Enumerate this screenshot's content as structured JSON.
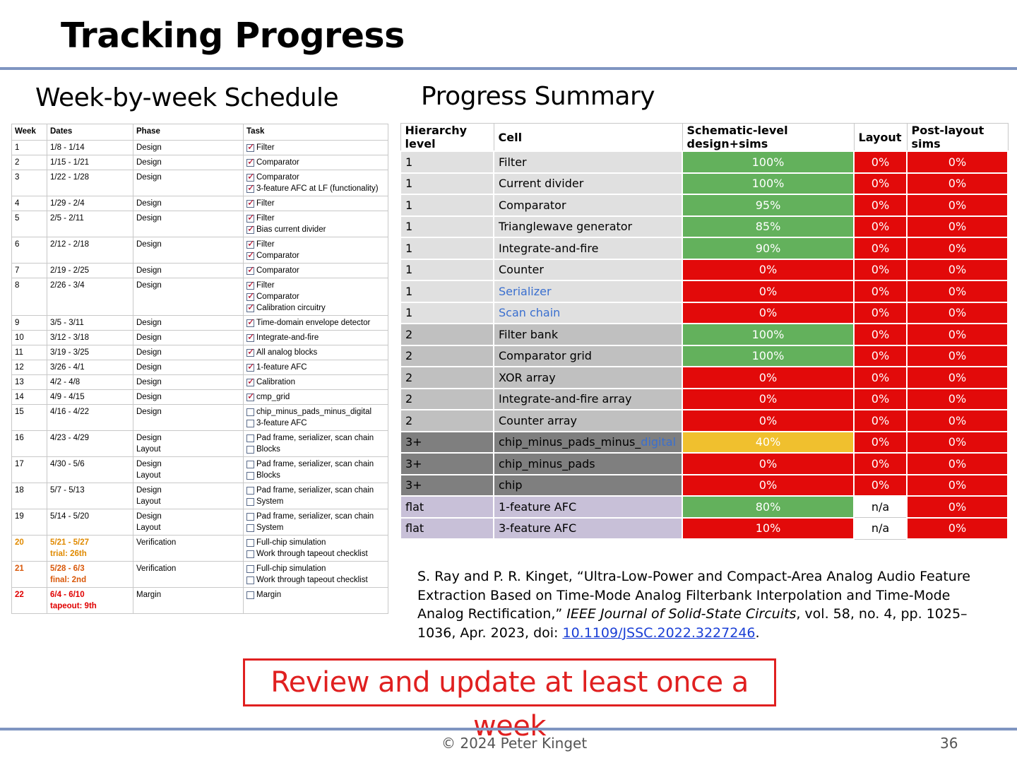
{
  "title": "Tracking Progress",
  "schedule": {
    "heading": "Week-by-week Schedule",
    "columns": [
      "Week",
      "Dates",
      "Phase",
      "Task"
    ],
    "rows": [
      {
        "week": "1",
        "dates": "1/8 - 1/14",
        "phase": [
          "Design"
        ],
        "tasks": [
          {
            "label": "Filter",
            "checked": true
          }
        ]
      },
      {
        "week": "2",
        "dates": "1/15 - 1/21",
        "phase": [
          "Design"
        ],
        "tasks": [
          {
            "label": "Comparator",
            "checked": true
          }
        ]
      },
      {
        "week": "3",
        "dates": "1/22 - 1/28",
        "phase": [
          "Design"
        ],
        "tasks": [
          {
            "label": "Comparator",
            "checked": true
          },
          {
            "label": "3-feature AFC at LF (functionality)",
            "checked": true
          }
        ]
      },
      {
        "week": "4",
        "dates": "1/29 - 2/4",
        "phase": [
          "Design"
        ],
        "tasks": [
          {
            "label": "Filter",
            "checked": true
          }
        ]
      },
      {
        "week": "5",
        "dates": "2/5 - 2/11",
        "phase": [
          "Design"
        ],
        "tasks": [
          {
            "label": "Filter",
            "checked": true
          },
          {
            "label": "Bias current divider",
            "checked": true
          }
        ]
      },
      {
        "week": "6",
        "dates": "2/12 - 2/18",
        "phase": [
          "Design"
        ],
        "tasks": [
          {
            "label": "Filter",
            "checked": true
          },
          {
            "label": "Comparator",
            "checked": true
          }
        ]
      },
      {
        "week": "7",
        "dates": "2/19 - 2/25",
        "phase": [
          "Design"
        ],
        "tasks": [
          {
            "label": "Comparator",
            "checked": true
          }
        ]
      },
      {
        "week": "8",
        "dates": "2/26 - 3/4",
        "phase": [
          "Design"
        ],
        "tasks": [
          {
            "label": "Filter",
            "checked": true
          },
          {
            "label": "Comparator",
            "checked": true
          },
          {
            "label": "Calibration circuitry",
            "checked": true
          }
        ]
      },
      {
        "week": "9",
        "dates": "3/5 - 3/11",
        "phase": [
          "Design"
        ],
        "tasks": [
          {
            "label": "Time-domain envelope detector",
            "checked": true
          }
        ]
      },
      {
        "week": "10",
        "dates": "3/12 - 3/18",
        "phase": [
          "Design"
        ],
        "tasks": [
          {
            "label": "Integrate-and-fire",
            "checked": true
          }
        ]
      },
      {
        "week": "11",
        "dates": "3/19 - 3/25",
        "phase": [
          "Design"
        ],
        "tasks": [
          {
            "label": "All analog blocks",
            "checked": true
          }
        ]
      },
      {
        "week": "12",
        "dates": "3/26 - 4/1",
        "phase": [
          "Design"
        ],
        "tasks": [
          {
            "label": "1-feature AFC",
            "checked": true
          }
        ]
      },
      {
        "week": "13",
        "dates": "4/2 - 4/8",
        "phase": [
          "Design"
        ],
        "tasks": [
          {
            "label": "Calibration",
            "checked": true
          }
        ]
      },
      {
        "week": "14",
        "dates": "4/9 - 4/15",
        "phase": [
          "Design"
        ],
        "tasks": [
          {
            "label": "cmp_grid",
            "checked": true
          }
        ]
      },
      {
        "week": "15",
        "dates": "4/16 - 4/22",
        "phase": [
          "Design"
        ],
        "tasks": [
          {
            "label": "chip_minus_pads_minus_digital",
            "checked": false
          },
          {
            "label": "3-feature AFC",
            "checked": false
          }
        ]
      },
      {
        "week": "16",
        "dates": "4/23 - 4/29",
        "phase": [
          "Design",
          "Layout"
        ],
        "tasks": [
          {
            "label": "Pad frame, serializer, scan chain",
            "checked": false
          },
          {
            "label": "Blocks",
            "checked": false
          }
        ]
      },
      {
        "week": "17",
        "dates": "4/30 - 5/6",
        "phase": [
          "Design",
          "Layout"
        ],
        "tasks": [
          {
            "label": "Pad frame, serializer, scan chain",
            "checked": false
          },
          {
            "label": "Blocks",
            "checked": false
          }
        ]
      },
      {
        "week": "18",
        "dates": "5/7 - 5/13",
        "phase": [
          "Design",
          "Layout"
        ],
        "tasks": [
          {
            "label": "Pad frame, serializer, scan chain",
            "checked": false
          },
          {
            "label": "System",
            "checked": false
          }
        ]
      },
      {
        "week": "19",
        "dates": "5/14 - 5/20",
        "phase": [
          "Design",
          "Layout"
        ],
        "tasks": [
          {
            "label": "Pad frame, serializer, scan chain",
            "checked": false
          },
          {
            "label": "System",
            "checked": false
          }
        ]
      },
      {
        "week": "20",
        "dates": "5/21 - 5/27",
        "note": "trial: 26th",
        "phase": [
          "Verification"
        ],
        "tasks": [
          {
            "label": "Full-chip simulation",
            "checked": false
          },
          {
            "label": "Work through tapeout checklist",
            "checked": false
          }
        ],
        "style": "late1"
      },
      {
        "week": "21",
        "dates": "5/28 - 6/3",
        "note": "final: 2nd",
        "phase": [
          "Verification"
        ],
        "tasks": [
          {
            "label": "Full-chip simulation",
            "checked": false
          },
          {
            "label": "Work through tapeout checklist",
            "checked": false
          }
        ],
        "style": "late2"
      },
      {
        "week": "22",
        "dates": "6/4 - 6/10",
        "note": "tapeout: 9th",
        "phase": [
          "Margin"
        ],
        "tasks": [
          {
            "label": "Margin",
            "checked": false
          }
        ],
        "style": "late3"
      }
    ]
  },
  "progress": {
    "heading": "Progress Summary",
    "columns": [
      "Hierarchy level",
      "Cell",
      "Schematic-level design+sims",
      "Layout",
      "Post-layout sims"
    ],
    "colors": {
      "green": "#63b15c",
      "red": "#e20a0a",
      "yellow": "#f0c02e"
    },
    "rows": [
      {
        "level": "1",
        "cell": "Filter",
        "schem": "100%",
        "layout": "0%",
        "post": "0%",
        "group": "lvl1",
        "schem_color": "green"
      },
      {
        "level": "1",
        "cell": "Current divider",
        "schem": "100%",
        "layout": "0%",
        "post": "0%",
        "group": "lvl1",
        "schem_color": "green"
      },
      {
        "level": "1",
        "cell": "Comparator",
        "schem": "95%",
        "layout": "0%",
        "post": "0%",
        "group": "lvl1",
        "schem_color": "green"
      },
      {
        "level": "1",
        "cell": "Trianglewave generator",
        "schem": "85%",
        "layout": "0%",
        "post": "0%",
        "group": "lvl1",
        "schem_color": "green"
      },
      {
        "level": "1",
        "cell": "Integrate-and-fire",
        "schem": "90%",
        "layout": "0%",
        "post": "0%",
        "group": "lvl1",
        "schem_color": "green"
      },
      {
        "level": "1",
        "cell": "Counter",
        "schem": "0%",
        "layout": "0%",
        "post": "0%",
        "group": "lvl1",
        "schem_color": "red"
      },
      {
        "level": "1",
        "cell": "Serializer",
        "schem": "0%",
        "layout": "0%",
        "post": "0%",
        "group": "lvl1",
        "schem_color": "red",
        "cell_blue": true
      },
      {
        "level": "1",
        "cell": "Scan chain",
        "schem": "0%",
        "layout": "0%",
        "post": "0%",
        "group": "lvl1",
        "schem_color": "red",
        "cell_blue": true
      },
      {
        "level": "2",
        "cell": "Filter bank",
        "schem": "100%",
        "layout": "0%",
        "post": "0%",
        "group": "lvl2",
        "schem_color": "green"
      },
      {
        "level": "2",
        "cell": "Comparator grid",
        "schem": "100%",
        "layout": "0%",
        "post": "0%",
        "group": "lvl2",
        "schem_color": "green"
      },
      {
        "level": "2",
        "cell": "XOR array",
        "schem": "0%",
        "layout": "0%",
        "post": "0%",
        "group": "lvl2",
        "schem_color": "red"
      },
      {
        "level": "2",
        "cell": "Integrate-and-fire array",
        "schem": "0%",
        "layout": "0%",
        "post": "0%",
        "group": "lvl2",
        "schem_color": "red"
      },
      {
        "level": "2",
        "cell": "Counter array",
        "schem": "0%",
        "layout": "0%",
        "post": "0%",
        "group": "lvl2",
        "schem_color": "red"
      },
      {
        "level": "3+",
        "cell": "chip_minus_pads_minus_",
        "cell_suffix": "digital",
        "schem": "40%",
        "layout": "0%",
        "post": "0%",
        "group": "lvl3",
        "schem_color": "yellow"
      },
      {
        "level": "3+",
        "cell": "chip_minus_pads",
        "schem": "0%",
        "layout": "0%",
        "post": "0%",
        "group": "lvl3",
        "schem_color": "red"
      },
      {
        "level": "3+",
        "cell": "chip",
        "schem": "0%",
        "layout": "0%",
        "post": "0%",
        "group": "lvl3",
        "schem_color": "red"
      },
      {
        "level": "flat",
        "cell": "1-feature AFC",
        "schem": "80%",
        "layout": "n/a",
        "post": "0%",
        "group": "flat",
        "schem_color": "green"
      },
      {
        "level": "flat",
        "cell": "3-feature AFC",
        "schem": "10%",
        "layout": "n/a",
        "post": "0%",
        "group": "flat",
        "schem_color": "red"
      }
    ]
  },
  "citation": {
    "before": "S. Ray and P. R. Kinget, “Ultra-Low-Power and Compact-Area Analog Audio Feature Extraction Based on Time-Mode Analog Filterbank Interpolation and Time-Mode Analog Rectification,” ",
    "journal": "IEEE Journal of Solid-State Circuits",
    "after": ", vol. 58, no. 4, pp. 1025–1036, Apr. 2023, doi: ",
    "doi": "10.1109/JSSC.2022.3227246",
    "end": "."
  },
  "callout": "Review and update at least once a week",
  "footer": {
    "copyright": "© 2024 Peter Kinget",
    "page": "36"
  }
}
